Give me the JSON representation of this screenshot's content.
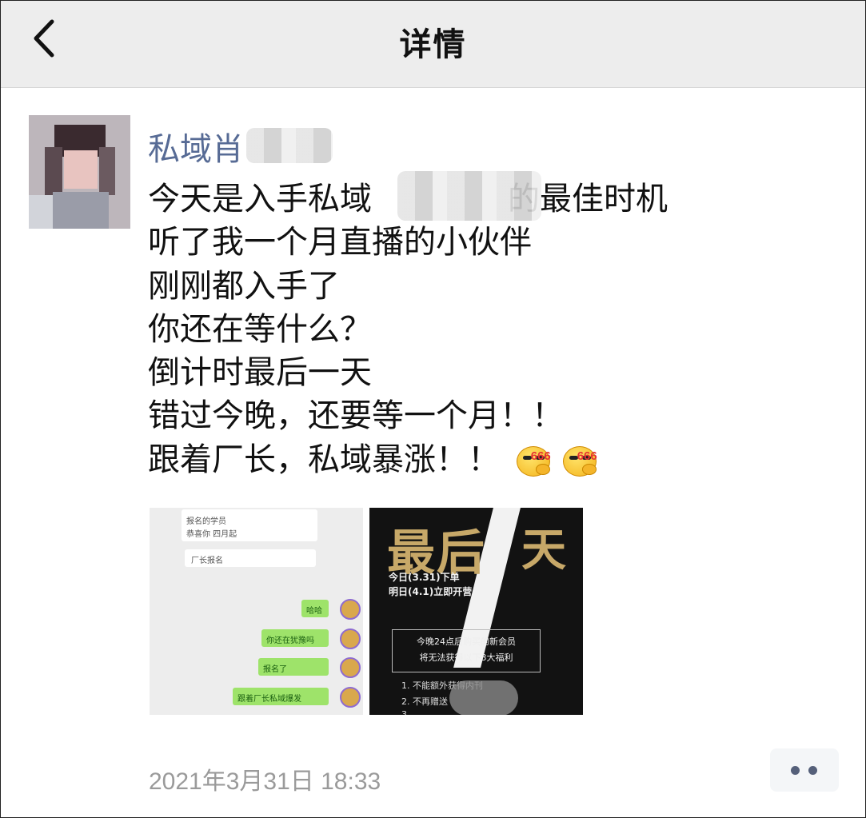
{
  "navbar": {
    "title": "详情",
    "back_icon": "chevron-left-icon"
  },
  "post": {
    "author": "私域肖",
    "lines": [
      "今天是入手私域",
      "的最佳时机",
      "听了我一个月直播的小伙伴",
      "刚刚都入手了",
      "你还在等什么？",
      "倒计时最后一天",
      "错过今晚，还要等一个月！！",
      "跟着厂长，私域暴涨！！"
    ],
    "emoji_label": "666",
    "timestamp": "2021年3月31日 18:33",
    "more_icon": "more-dots-icon"
  },
  "images": {
    "chat": {
      "lines_left": [
        "报名的学员",
        "恭喜你 四月起",
        "厂长报名"
      ],
      "lines_right": [
        "哈哈",
        "你还在犹豫吗",
        "报名了",
        "跟着厂长私域爆发"
      ]
    },
    "poster": {
      "title_a": "最后",
      "title_b": "天",
      "sub1": "今日(3.31)下单",
      "sub2": "明日(4.1)立即开营",
      "box1": "今晚24点后购买的新会员",
      "box2": "将无法获得以下3大福利",
      "list": [
        "1. 不能额外获得内刊",
        "2. 不再赠送",
        "3."
      ]
    }
  },
  "colors": {
    "nickname": "#576b95",
    "timestamp": "#9a9a9a",
    "navbar_bg": "#ededed"
  }
}
